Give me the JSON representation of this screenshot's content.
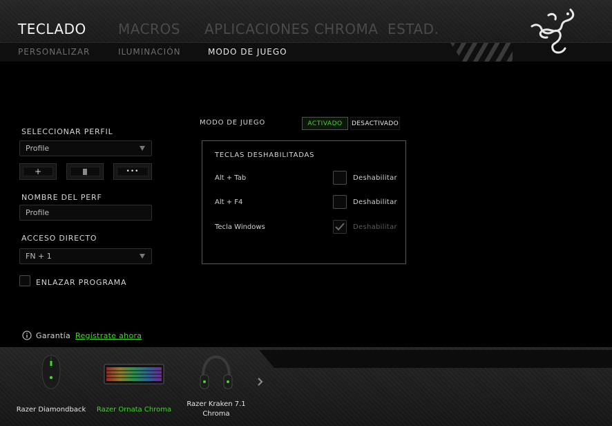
{
  "header": {
    "tabs": [
      {
        "label": "TECLADO",
        "active": true
      },
      {
        "label": "MACROS",
        "active": false
      },
      {
        "label": "APLICACIONES CHROMA",
        "active": false
      },
      {
        "label": "ESTAD.",
        "active": false
      }
    ],
    "subtabs": [
      {
        "label": "PERSONALIZAR",
        "active": false
      },
      {
        "label": "ILUMINACIÓN",
        "active": false
      },
      {
        "label": "MODO DE JUEGO",
        "active": true
      }
    ],
    "logo_icon": "razer-snake-logo"
  },
  "sidebar": {
    "select_profile_label": "SELECCIONAR PERFIL",
    "profile_value": "Profile",
    "add_button": "+",
    "more_button": "•••",
    "profile_name_label": "NOMBRE DEL PERF",
    "profile_name_value": "Profile",
    "shortcut_label": "ACCESO DIRECTO",
    "shortcut_value": "FN + 1",
    "link_program_label": "ENLAZAR PROGRAMA",
    "link_program_checked": false
  },
  "gamemode": {
    "label": "MODO DE JUEGO",
    "on_label": "ACTIVADO",
    "off_label": "DESACTIVADO",
    "state": "on"
  },
  "disabled_keys": {
    "title": "TECLAS DESHABILITADAS",
    "rows": [
      {
        "key": "Alt + Tab",
        "action": "Deshabilitar",
        "checked": false,
        "enabled": true
      },
      {
        "key": "Alt + F4",
        "action": "Deshabilitar",
        "checked": false,
        "enabled": true
      },
      {
        "key": "Tecla Windows",
        "action": "Deshabilitar",
        "checked": true,
        "enabled": false
      }
    ]
  },
  "warranty": {
    "label": "Garantía",
    "link": "Regístrate ahora"
  },
  "devices": [
    {
      "name": "Razer Diamondback",
      "active": false
    },
    {
      "name": "Razer Ornata Chroma",
      "active": true
    },
    {
      "name": "Razer Kraken 7.1 Chroma",
      "active": false
    }
  ],
  "colors": {
    "accent": "#44d62c",
    "background": "#000000",
    "muted_tab": "#4a4a4a"
  }
}
